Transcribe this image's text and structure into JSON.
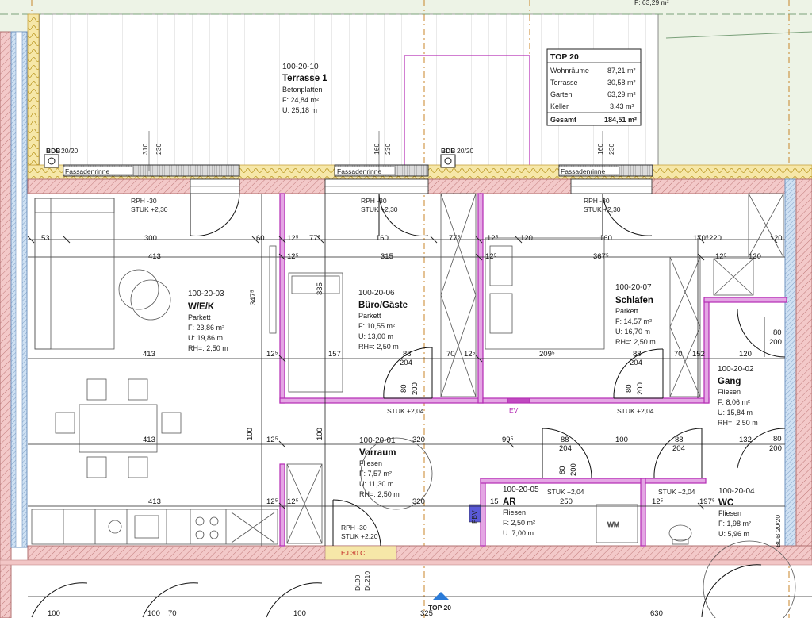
{
  "summary": {
    "title": "TOP 20",
    "rows": [
      {
        "label": "Wohnräume",
        "value": "87,21 m²"
      },
      {
        "label": "Terrasse",
        "value": "30,58 m²"
      },
      {
        "label": "Garten",
        "value": "63,29 m²"
      },
      {
        "label": "Keller",
        "value": "3,43 m²"
      }
    ],
    "total_label": "Gesamt",
    "total_value": "184,51 m²"
  },
  "top_right_area": "F: 63,29 m²",
  "terrace": {
    "number": "100-20-10",
    "name": "Terrasse 1",
    "floor": "Betonplatten",
    "area": "F: 24,84 m²",
    "perimeter": "U: 25,18 m"
  },
  "rooms": {
    "wek": {
      "number": "100-20-03",
      "name": "W/E/K",
      "floor": "Parkett",
      "area": "F: 23,86 m²",
      "perimeter": "U: 19,86 m",
      "height": "RH=: 2,50 m"
    },
    "buero": {
      "number": "100-20-06",
      "name": "Büro/Gäste",
      "floor": "Parkett",
      "area": "F: 10,55 m²",
      "perimeter": "U: 13,00 m",
      "height": "RH=: 2,50 m"
    },
    "schlafen": {
      "number": "100-20-07",
      "name": "Schlafen",
      "floor": "Parkett",
      "area": "F: 14,57 m²",
      "perimeter": "U: 16,70 m",
      "height": "RH=: 2,50 m"
    },
    "gang": {
      "number": "100-20-02",
      "name": "Gang",
      "floor": "Fliesen",
      "area": "F: 8,06 m²",
      "perimeter": "U: 15,84 m",
      "height": "RH=: 2,50 m"
    },
    "vorraum": {
      "number": "100-20-01",
      "name": "Vorraum",
      "floor": "Fliesen",
      "area": "F: 7,57 m²",
      "perimeter": "U: 11,30 m",
      "height": "RH=: 2,50 m"
    },
    "ar": {
      "number": "100-20-05",
      "name": "AR",
      "floor": "Fliesen",
      "area": "F: 2,50 m²",
      "perimeter": "U: 7,00 m"
    },
    "wc": {
      "number": "100-20-04",
      "name": "WC",
      "floor": "Fliesen",
      "area": "F: 1,98 m²",
      "perimeter": "U: 5,96 m"
    }
  },
  "labels": {
    "fassadenrinne": "Fassadenrinne",
    "bdb": "BDB",
    "bdb_dim": "20/20",
    "rph": "RPH -30",
    "stuk230": "STUK +2,30",
    "stuk204": "STUK +2,04",
    "stuk220": "STUK +2,20",
    "ev": "EV",
    "fbv": "FBV",
    "wm": "WM",
    "top20_marker": "TOP 20",
    "parap_a": "310",
    "parap_b": "230",
    "parap_c": "160",
    "parap_d": "230",
    "parap_e": "160",
    "parap_f": "230",
    "dl90": "DL90",
    "dl210": "DL210",
    "bdb_right": "BDB 20/20"
  },
  "dimensions": {
    "row1": [
      "53",
      "300",
      "60",
      "12⁵",
      "77⁵",
      "160",
      "77⁵",
      "12⁵",
      "120",
      "160",
      "170⁵",
      "220",
      "20"
    ],
    "row2": [
      "413",
      "12⁵",
      "315",
      "12⁵",
      "367⁵",
      "12⁵",
      "120"
    ],
    "row3": [
      "413",
      "12⁵",
      "157",
      "88",
      "204",
      "70",
      "12⁵",
      "209⁵",
      "88",
      "204",
      "70",
      "152",
      "120",
      "200",
      "80"
    ],
    "row4": [
      "413",
      "12⁵",
      "100",
      "320",
      "99⁵",
      "88",
      "204",
      "100",
      "88",
      "204",
      "132",
      "200",
      "80"
    ],
    "row5": [
      "413",
      "12⁵",
      "12⁵",
      "320",
      "15",
      "250",
      "12⁵",
      "197⁵"
    ],
    "vertical": [
      "347⁵",
      "335",
      "100",
      "100",
      "80",
      "200",
      "80",
      "200",
      "80",
      "200"
    ],
    "bottom": [
      "100",
      "100",
      "70",
      "100",
      "325",
      "630"
    ],
    "right_top": [
      "80",
      "200"
    ],
    "right_mid": [
      "80",
      "200"
    ]
  }
}
